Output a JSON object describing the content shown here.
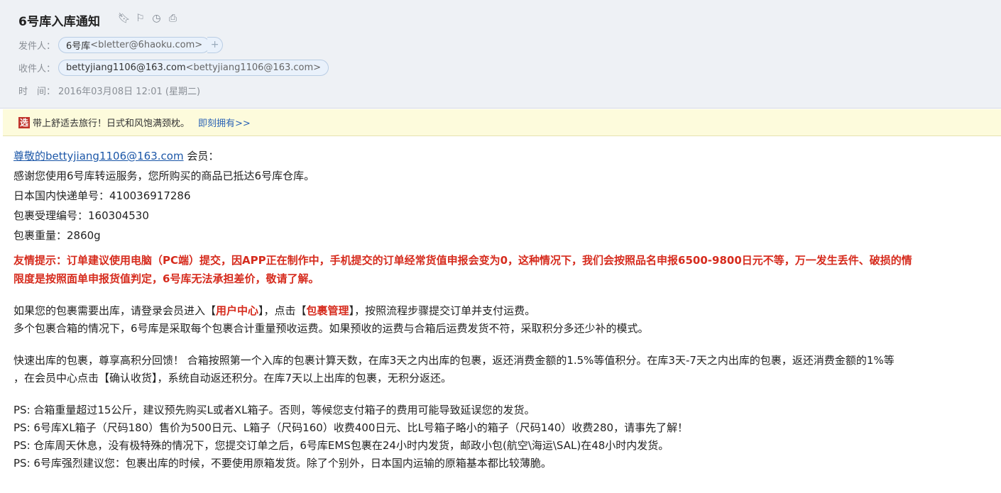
{
  "header": {
    "subject": "6号库入库通知",
    "icons": [
      "bookmark-icon",
      "flag-icon",
      "clock-icon",
      "print-icon"
    ],
    "from_label": "发件人：",
    "from_name": "6号库",
    "from_email": "<bletter@6haoku.com>",
    "add_label": "+",
    "to_label": "收件人：",
    "to_name": "bettyjiang1106@163.com",
    "to_email": "<bettyjiang1106@163.com>",
    "time_label": "时　间：",
    "time_value": "2016年03月08日 12:01 (星期二)"
  },
  "ad": {
    "logo": "选",
    "text": "带上舒适去旅行！日式和风饱满颈枕。",
    "link": "即刻拥有>>"
  },
  "body": {
    "greeting_link": "尊敬的bettyjiang1106@163.com",
    "greeting_rest": " 会员：",
    "line1": "感谢您使用6号库转运服务，您所购买的商品已抵达6号库仓库。",
    "line2": "日本国内快递单号：410036917286",
    "line3": "包裹受理编号：160304530",
    "line4": "包裹重量：2860g",
    "warn1": "友情提示：订单建议使用电脑（PC端）提交，因APP正在制作中，手机提交的订单经常货值申报会变为0，这种情况下，我们会按照品名申报6500-9800日元不等，万一发生丢件、破损的情",
    "warn2": "限度是按照面单申报货值判定，6号库无法承担差价，敬请了解。",
    "p1_a": "如果您的包裹需要出库，请登录会员进入【",
    "p1_b": "用户中心",
    "p1_c": "】，点击【",
    "p1_d": "包裹管理",
    "p1_e": "】，按照流程步骤提交订单并支付运费。",
    "p2": "多个包裹合箱的情况下，6号库是采取每个包裹合计重量预收运费。如果预收的运费与合箱后运费发货不符，采取积分多还少补的模式。",
    "p3": "快速出库的包裹，尊享高积分回馈！ 合箱按照第一个入库的包裹计算天数，在库3天之内出库的包裹，返还消费金额的1.5%等值积分。在库3天-7天之内出库的包裹，返还消费金额的1%等",
    "p4": "，在会员中心点击【确认收货】，系统自动返还积分。在库7天以上出库的包裹，无积分返还。",
    "ps1": "PS: 合箱重量超过15公斤，建议预先购买L或者XL箱子。否则，等候您支付箱子的费用可能导致延误您的发货。",
    "ps2": "PS: 6号库XL箱子（尺码180）售价为500日元、L箱子（尺码160）收费400日元、比L号箱子略小的箱子（尺码140）收费280，请事先了解！",
    "ps3": "PS: 仓库周天休息，没有极特殊的情况下，您提交订单之后，6号库EMS包裹在24小时内发货，邮政小包(航空\\海运\\SAL)在48小时内发货。",
    "ps4": "PS: 6号库强烈建议您：包裹出库的时候，不要使用原箱发货。除了个别外，日本国内运输的原箱基本都比较薄脆。"
  }
}
